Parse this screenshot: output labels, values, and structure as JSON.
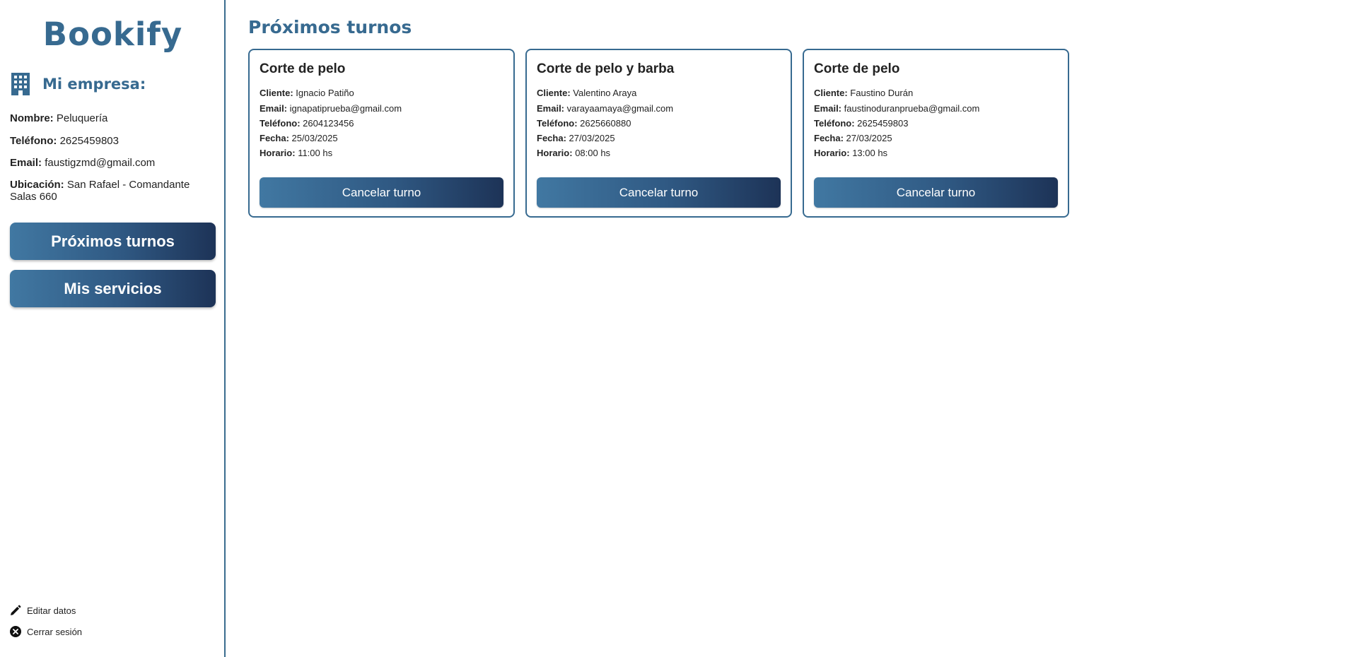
{
  "sidebar": {
    "brand": "Bookify",
    "company_heading": "Mi empresa:",
    "fields": {
      "name_label": "Nombre:",
      "name_value": "Peluquería",
      "phone_label": "Teléfono:",
      "phone_value": "2625459803",
      "email_label": "Email:",
      "email_value": "faustigzmd@gmail.com",
      "location_label": "Ubicación:",
      "location_value": "San Rafael - Comandante Salas 660"
    },
    "nav": {
      "upcoming": "Próximos turnos",
      "services": "Mis servicios"
    },
    "footer": {
      "edit": "Editar datos",
      "logout": "Cerrar sesión"
    }
  },
  "main": {
    "title": "Próximos turnos",
    "labels": {
      "client": "Cliente:",
      "email": "Email:",
      "phone": "Teléfono:",
      "date": "Fecha:",
      "time": "Horario:"
    },
    "cancel_label": "Cancelar turno",
    "appointments": [
      {
        "service": "Corte de pelo",
        "client": "Ignacio Patiño",
        "email": "ignapatiprueba@gmail.com",
        "phone": "2604123456",
        "date": "25/03/2025",
        "time": "11:00 hs"
      },
      {
        "service": "Corte de pelo y barba",
        "client": "Valentino Araya",
        "email": "varayaamaya@gmail.com",
        "phone": "2625660880",
        "date": "27/03/2025",
        "time": "08:00 hs"
      },
      {
        "service": "Corte de pelo",
        "client": "Faustino Durán",
        "email": "faustinoduranprueba@gmail.com",
        "phone": "2625459803",
        "date": "27/03/2025",
        "time": "13:00 hs"
      }
    ]
  },
  "colors": {
    "accent": "#376a90",
    "button_start": "#4178a2",
    "button_end": "#1d3357"
  }
}
